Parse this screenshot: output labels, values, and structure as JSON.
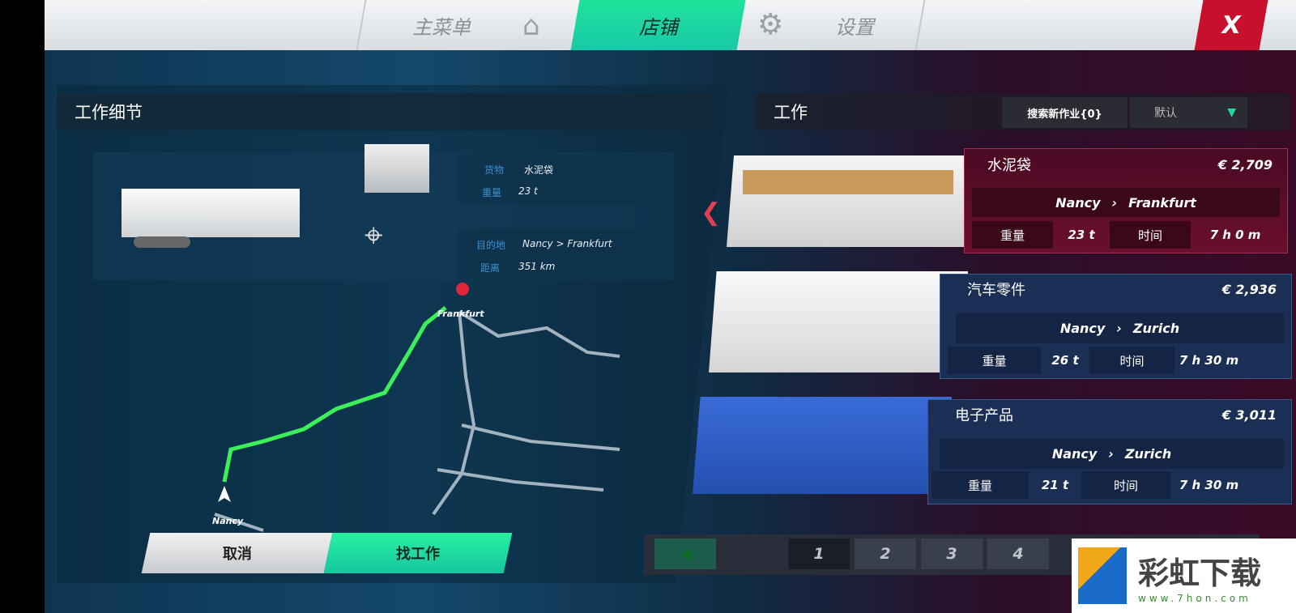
{
  "nav": {
    "tabs": [
      {
        "label": "主菜单",
        "icon": "home-icon"
      },
      {
        "label": "店铺",
        "active": true
      },
      {
        "label": "设置",
        "icon": "gear-icon"
      }
    ],
    "close_label": "X"
  },
  "details": {
    "title": "工作细节",
    "cargo_label": "货物",
    "cargo": "水泥袋",
    "weight_label": "重量",
    "weight": "23 t",
    "dest_label": "目的地",
    "dest": "Nancy > Frankfurt",
    "dist_label": "距离",
    "dist": "351 km",
    "map": {
      "start": "Nancy",
      "end": "Frankfurt"
    },
    "cancel": "取消",
    "find": "找工作"
  },
  "jobs": {
    "title": "工作",
    "search": "搜索新作业{0}",
    "sort": "默认",
    "weight_label": "重量",
    "time_label": "时间",
    "items": [
      {
        "cargo": "水泥袋",
        "price": "€ 2,709",
        "from": "Nancy",
        "to": "Frankfurt",
        "weight": "23 t",
        "time": "7 h 0 m",
        "selected": true
      },
      {
        "cargo": "汽车零件",
        "price": "€ 2,936",
        "from": "Nancy",
        "to": "Zurich",
        "weight": "26 t",
        "time": "7 h 30 m"
      },
      {
        "cargo": "电子产品",
        "price": "€ 3,011",
        "from": "Nancy",
        "to": "Zurich",
        "weight": "21 t",
        "time": "7 h 30 m"
      }
    ],
    "pages": [
      "1",
      "2",
      "3",
      "4"
    ]
  },
  "watermark": {
    "text": "彩虹下载",
    "url": "www.7hon.com"
  },
  "colors": {
    "accent": "#1fe39a",
    "close": "#c8102e",
    "selected_card": "#6a0f2e",
    "card": "#1b2f55"
  }
}
